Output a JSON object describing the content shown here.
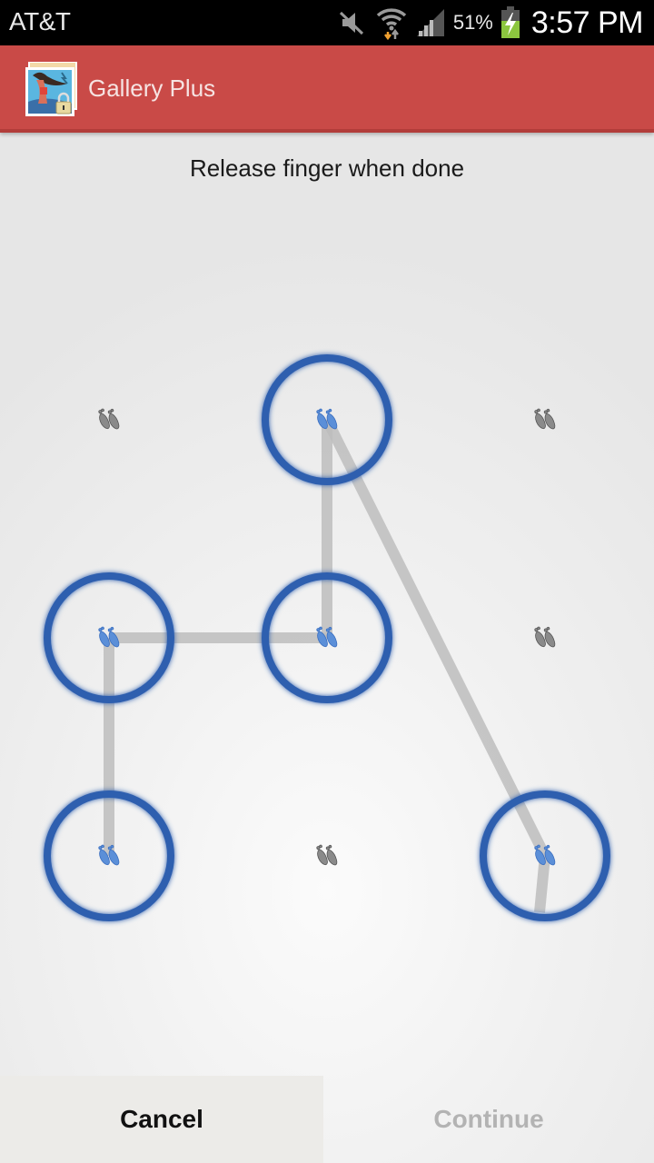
{
  "status_bar": {
    "carrier": "AT&T",
    "icons": [
      "mute-icon",
      "wifi-icon",
      "signal-icon",
      "battery-charging-icon"
    ],
    "battery_percent": "51%",
    "time": "3:57 PM"
  },
  "app_bar": {
    "title": "Gallery Plus",
    "icon": "gallery-lock-icon",
    "color": "#c94a47"
  },
  "instruction": "Release finger when done",
  "pattern": {
    "grid_rows": 3,
    "grid_cols": 3,
    "node_icon": "footprint-icon",
    "selected_color": "#2f5faf",
    "line_color": "#bdbdbd",
    "selected_nodes": [
      [
        0,
        1
      ],
      [
        1,
        1
      ],
      [
        1,
        0
      ],
      [
        2,
        0
      ],
      [
        2,
        2
      ]
    ],
    "sequence": [
      {
        "row": 2,
        "col": 0
      },
      {
        "row": 1,
        "col": 0
      },
      {
        "row": 1,
        "col": 1
      },
      {
        "row": 0,
        "col": 1
      },
      {
        "row": 2,
        "col": 2
      }
    ],
    "released": true
  },
  "buttons": {
    "cancel": "Cancel",
    "continue": "Continue",
    "continue_enabled": false
  }
}
